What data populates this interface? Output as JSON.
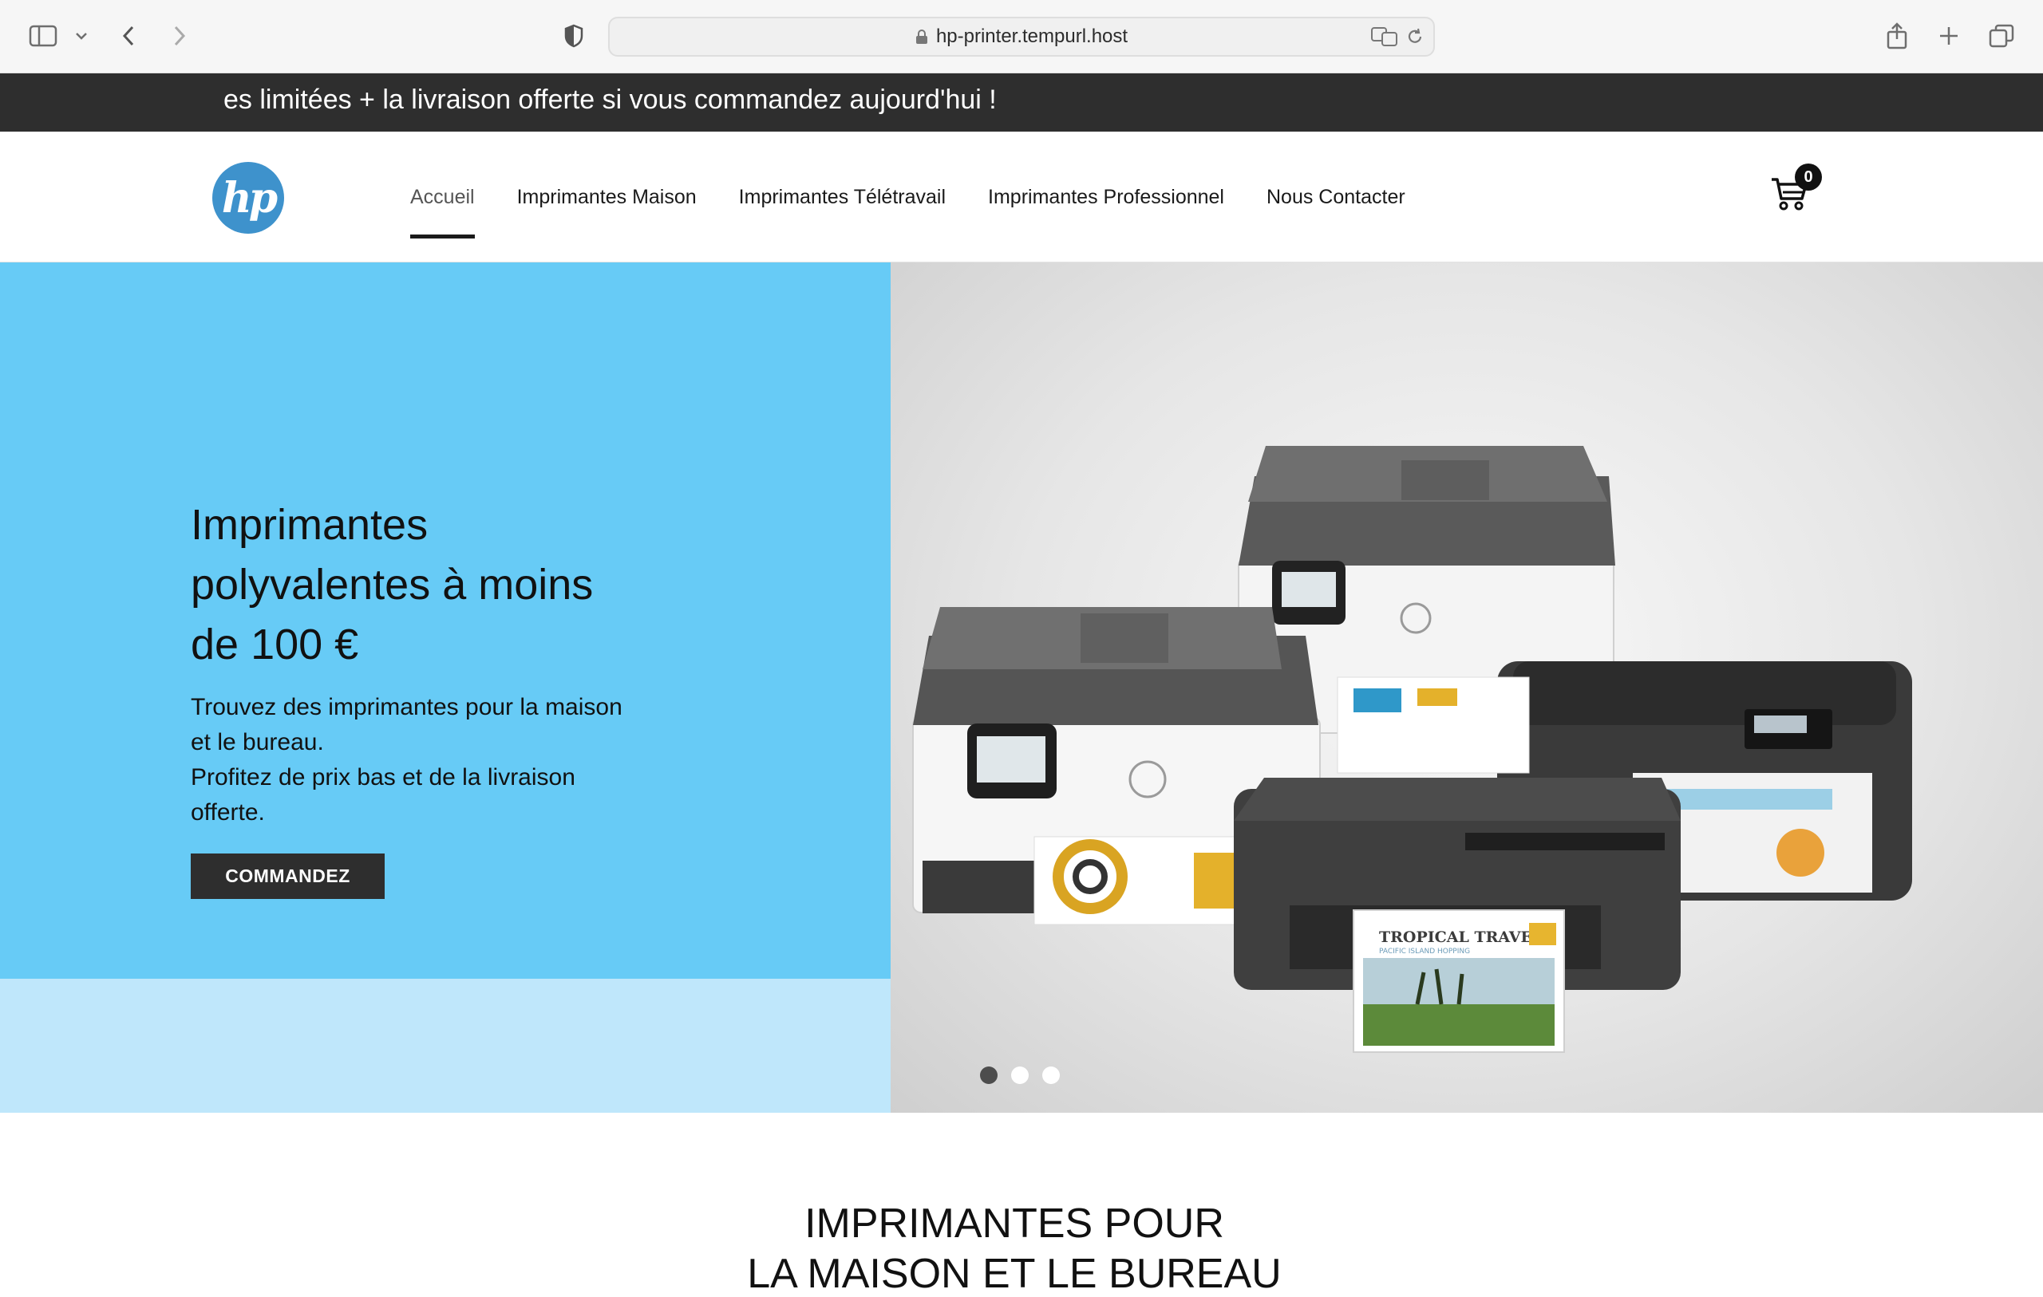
{
  "browser": {
    "url": "hp-printer.tempurl.host"
  },
  "announcement": {
    "text": "es limitées + la livraison offerte si vous commandez aujourd'hui !"
  },
  "header": {
    "logo_text": "hp",
    "nav": [
      {
        "label": "Accueil",
        "active": true
      },
      {
        "label": "Imprimantes Maison"
      },
      {
        "label": "Imprimantes Télétravail"
      },
      {
        "label": "Imprimantes Professionnel"
      },
      {
        "label": "Nous Contacter"
      }
    ],
    "cart_count": "0"
  },
  "hero": {
    "title": "Imprimantes polyvalentes à moins de 100 €",
    "subtitle_line1": "Trouvez des imprimantes pour la maison et le bureau.",
    "subtitle_line2": "Profitez de prix bas et de la livraison offerte.",
    "cta_label": "COMMANDEZ",
    "paper_heading": "TROPICAL TRAVEL",
    "paper_subheading": "PACIFIC ISLAND HOPPING",
    "slides": [
      {
        "active": true
      },
      {
        "active": false
      },
      {
        "active": false
      }
    ]
  },
  "section": {
    "title_line1": "IMPRIMANTES POUR",
    "title_line2": "LA MAISON ET LE BUREAU"
  },
  "colors": {
    "hero_blue": "#67cbf6",
    "hero_blue_light": "#bfe7fb",
    "announcement_bg": "#2e2e2e",
    "hp_blue": "#3e92cc"
  }
}
